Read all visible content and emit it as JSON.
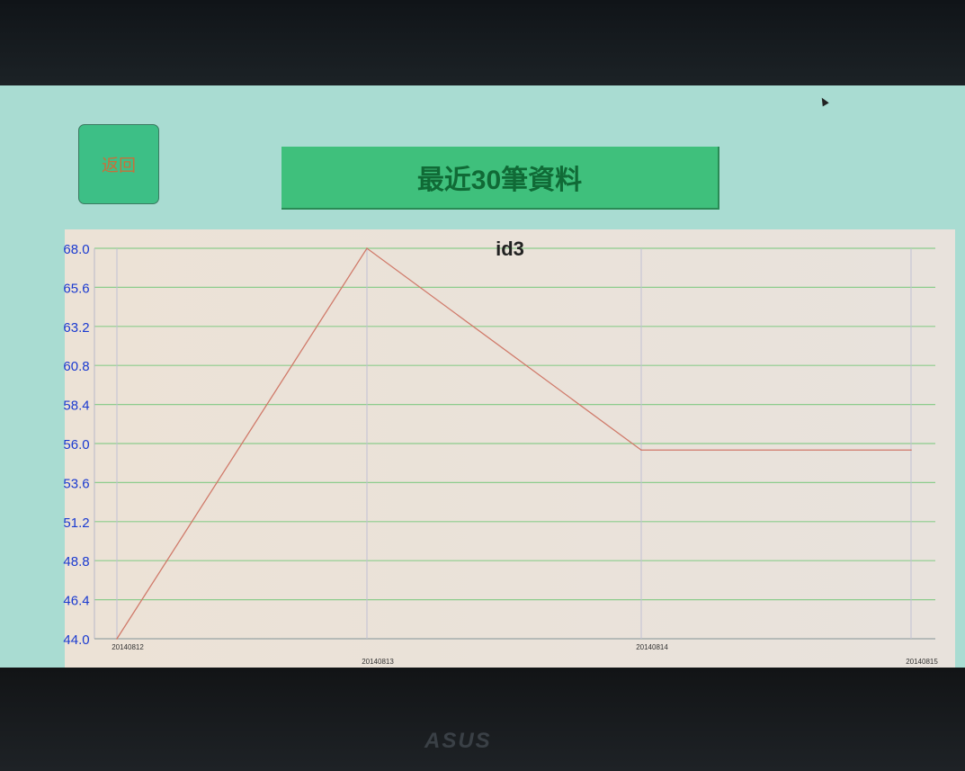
{
  "header": {
    "back_label": "返回",
    "title": "最近30筆資料"
  },
  "device": {
    "brand_logo": "ASUS"
  },
  "colors": {
    "line": "#d07a6a",
    "grid": "#8ccc8c",
    "ytick": "#1a3ad0",
    "background": "#a9dcd2"
  },
  "chart_data": {
    "type": "line",
    "title": "id3",
    "xlabel": "",
    "ylabel": "",
    "categories": [
      "20140812",
      "20140813",
      "20140814",
      "20140815"
    ],
    "series": [
      {
        "name": "id3",
        "values": [
          44.0,
          68.0,
          55.6,
          55.6
        ]
      }
    ],
    "ylim": [
      44.0,
      68.0
    ],
    "yticks": [
      "68.0",
      "65.6",
      "63.2",
      "60.8",
      "58.4",
      "56.0",
      "53.6",
      "51.2",
      "48.8",
      "46.4",
      "44.0"
    ],
    "grid": true,
    "legend": "none"
  }
}
